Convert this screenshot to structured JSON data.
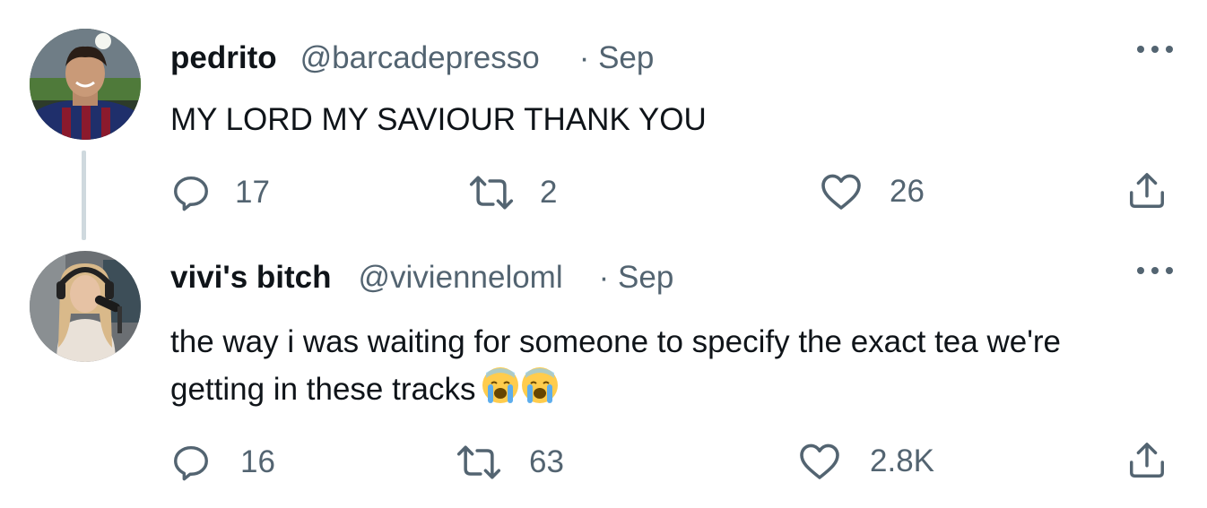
{
  "tweets": [
    {
      "name": "pedrito",
      "handle": "@barcadepresso",
      "date": "· Sep",
      "text_lines": [
        "MY LORD MY SAVIOUR THANK YOU"
      ],
      "replies": "17",
      "retweets": "2",
      "likes": "26",
      "avatar_icon": "profile-photo-football-player"
    },
    {
      "name": "vivi's bitch",
      "handle": "@vivienneloml",
      "date": "· Sep",
      "text_lines": [
        "the way i was waiting for someone to specify the exact tea we're",
        "getting in these tracks"
      ],
      "emoji": "😭😭",
      "replies": "16",
      "retweets": "63",
      "likes": "2.8K",
      "avatar_icon": "profile-photo-singer-microphone"
    }
  ],
  "colors": {
    "text": "#0f1419",
    "secondary": "#536471",
    "thread_line": "#cfd9de"
  },
  "icons": [
    "reply-icon",
    "retweet-icon",
    "like-icon",
    "share-icon",
    "more-options-icon"
  ]
}
